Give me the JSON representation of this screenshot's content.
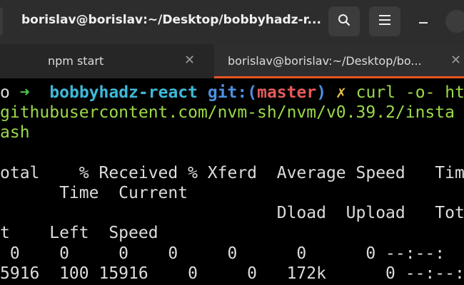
{
  "window": {
    "title": "borislav@borislav:~/Desktop/bobbyhadz-r..."
  },
  "tabs": [
    {
      "label": "npm start"
    },
    {
      "label": "borislav@borislav:~/Desktop/bo..."
    }
  ],
  "colors": {
    "active_tab_underline": "#e95420",
    "prompt_arrow": "#4ec94e",
    "directory": "#3fb8d8",
    "git_label": "#4f8fe0",
    "branch": "#e55b5b",
    "dirty_marker": "#e6c34a",
    "command": "#9bd94a"
  },
  "icons": {
    "search": "search-icon",
    "menu": "hamburger-menu-icon",
    "minimize": "minimize-icon",
    "close": "close-icon"
  },
  "terminal": {
    "prompt": {
      "lead": "o",
      "arrow": "➜",
      "directory": "bobbyhadz-react",
      "git_prefix": "git:(",
      "branch": "master",
      "git_suffix": ")",
      "dirty": "✗",
      "command": "curl -o- ht"
    },
    "lines": [
      "githubusercontent.com/nvm-sh/nvm/v0.39.2/insta",
      "ash",
      "",
      "otal    % Received % Xferd  Average Speed   Tim",
      "      Time  Current",
      "                            Dload  Upload   Tot",
      "t    Left  Speed",
      " 0    0     0    0     0      0      0 --:--:",
      "5916  100 15916    0     0   172k      0 --:--:"
    ]
  }
}
